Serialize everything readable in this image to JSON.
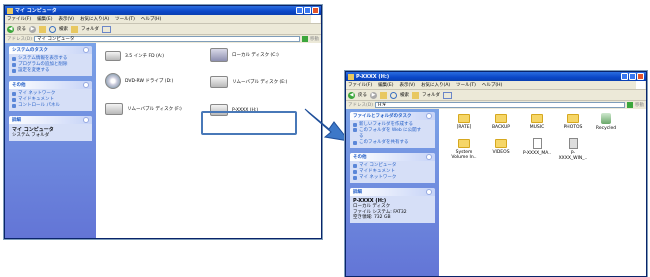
{
  "window1": {
    "title": "マイ コンピュータ",
    "menu": [
      "ファイル(F)",
      "編集(E)",
      "表示(V)",
      "お気に入り(A)",
      "ツール(T)",
      "ヘルプ(H)"
    ],
    "toolbar": {
      "back": "戻る",
      "search": "検索",
      "folders": "フォルダ"
    },
    "address_label": "アドレス(D)",
    "address_value": "マイ コンピュータ",
    "go_label": "移動",
    "tasks_title": "システムのタスク",
    "tasks": [
      "システム情報を表示する",
      "プログラムの追加と削除",
      "設定を変更する"
    ],
    "other_title": "その他",
    "other": [
      "マイ ネットワーク",
      "マイドキュメント",
      "コントロール パネル"
    ],
    "details_title": "詳細",
    "details_name": "マイ コンピュータ",
    "details_sub": "システム フォルダ",
    "drives": [
      {
        "label": "3.5 インチ FD (A:)",
        "icon": "floppy-drive-icon"
      },
      {
        "label": "ローカル ディスク (C:)",
        "icon": "local-disk-icon"
      },
      {
        "label": "DVD-RW ドライブ (D:)",
        "icon": "dvd-drive-icon"
      },
      {
        "label": "リムーバブル ディスク (E:)",
        "icon": "removable-disk-icon"
      },
      {
        "label": "リムーバブル ディスク (F:)",
        "icon": "removable-disk-icon"
      },
      {
        "label": "P-XXXX (H:)",
        "icon": "removable-disk-icon"
      }
    ]
  },
  "window2": {
    "title": "P-XXXX (H:)",
    "menu": [
      "ファイル(F)",
      "編集(E)",
      "表示(V)",
      "お気に入り(A)",
      "ツール(T)",
      "ヘルプ(H)"
    ],
    "toolbar": {
      "back": "戻る",
      "search": "検索",
      "folders": "フォルダ"
    },
    "address_label": "アドレス(D)",
    "address_value": "H:¥",
    "go_label": "移動",
    "tasks_title": "ファイルとフォルダのタスク",
    "tasks": [
      "新しいフォルダを作成する",
      "このフォルダを Web に公開する",
      "このフォルダを共有する"
    ],
    "other_title": "その他",
    "other": [
      "マイ コンピュータ",
      "マイドキュメント",
      "マイ ネットワーク"
    ],
    "details_title": "詳細",
    "details_name": "P-XXXX (H:)",
    "details_lines": [
      "ローカル ディスク",
      "ファイル システム: FAT32",
      "空き領域: 732 GB"
    ],
    "items": [
      {
        "label": "[RATE]",
        "icon": "folder-icon"
      },
      {
        "label": "BACKUP",
        "icon": "folder-icon"
      },
      {
        "label": "MUSIC",
        "icon": "folder-icon"
      },
      {
        "label": "PHOTOS",
        "icon": "folder-icon"
      },
      {
        "label": "Recycled",
        "icon": "recycle-bin-icon"
      },
      {
        "label": "System Volume In..",
        "icon": "folder-icon"
      },
      {
        "label": "VIDEOS",
        "icon": "folder-icon"
      },
      {
        "label": "P-XXXX_MA..",
        "icon": "file-icon"
      },
      {
        "label": "P-XXXX_WIN_..",
        "icon": "file-icon"
      }
    ]
  },
  "colors": {
    "title_bar": "#0b47c8",
    "task_pane": "#6f8ce0",
    "arrow": "#3d78c8",
    "highlight": "#4878b8"
  }
}
